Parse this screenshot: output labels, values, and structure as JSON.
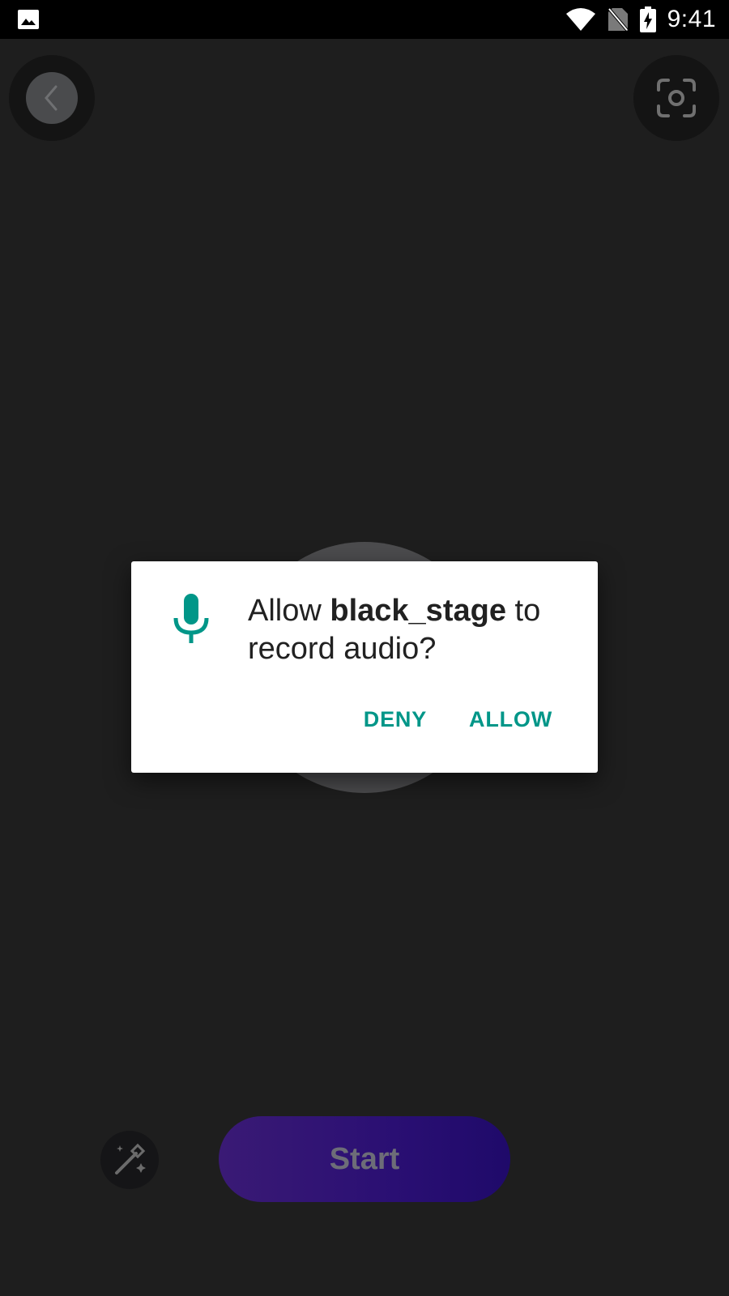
{
  "status_bar": {
    "time": "9:41",
    "icons": [
      "image-icon",
      "wifi-icon",
      "no-sim-icon",
      "battery-charging-icon"
    ]
  },
  "app": {
    "back_icon": "chevron-left-icon",
    "camera_icon": "camera-flip-icon",
    "magic_icon": "magic-wand-icon",
    "start_label": "Start"
  },
  "dialog": {
    "icon": "microphone-icon",
    "message_prefix": "Allow ",
    "app_name": "black_stage",
    "message_suffix": " to record audio?",
    "deny_label": "DENY",
    "allow_label": "ALLOW",
    "accent_color": "#009688"
  }
}
